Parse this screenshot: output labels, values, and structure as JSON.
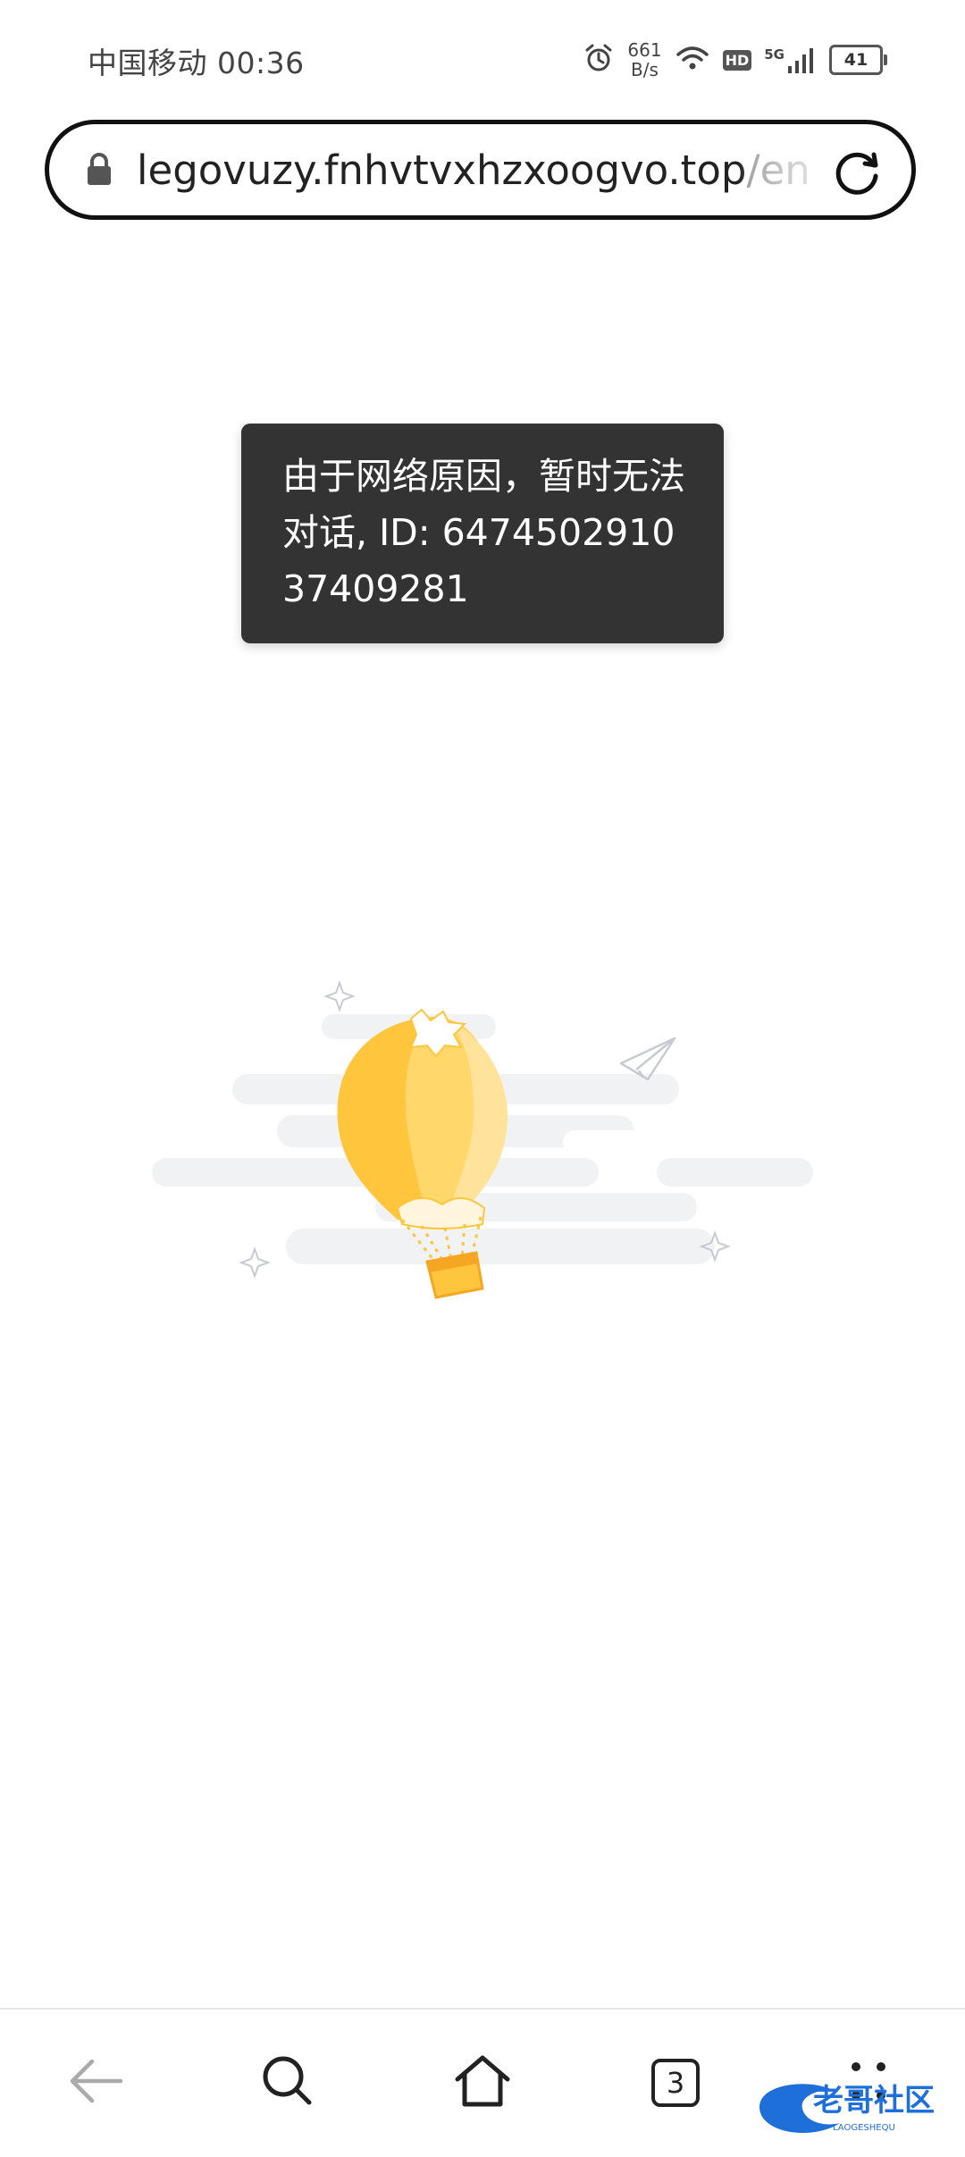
{
  "status_bar": {
    "carrier_time": "中国移动 00:36",
    "net_speed_value": "661",
    "net_speed_unit": "B/s",
    "hd_label": "HD",
    "network_label": "5G",
    "battery": "41",
    "icons": [
      "alarm-icon",
      "wifi-icon",
      "hd-icon",
      "signal-icon",
      "battery-icon"
    ]
  },
  "address_bar": {
    "url_host": "legovuzy.fnhvtvxhzxoogvo.top",
    "url_path": "/en",
    "icons": [
      "lock-icon",
      "reload-icon"
    ]
  },
  "toast": {
    "message": "由于网络原因，暂时无法对话, ID: 647450291037409281"
  },
  "illustration": {
    "name": "hot-air-balloon-empty-state",
    "colors": {
      "balloon_dark": "#FFC53D",
      "balloon_light": "#FFE39A",
      "cloud": "#F1F2F4"
    }
  },
  "bottom_nav": {
    "tab_count": "3",
    "icons": [
      "back-arrow-icon",
      "search-icon",
      "home-icon",
      "tabs-icon",
      "more-icon"
    ]
  },
  "watermark": {
    "text": "老哥社区",
    "subtext": "LAOGESHEQU"
  }
}
